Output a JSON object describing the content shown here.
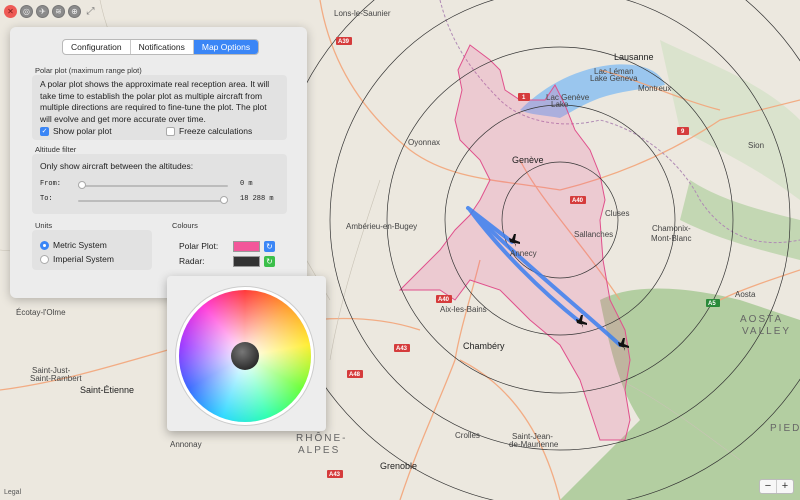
{
  "window": {
    "close_glyph": "✕",
    "toolbar_icons": [
      "radar-icon",
      "aircraft-icon",
      "layers-icon",
      "globe-icon"
    ],
    "expand_glyph": "⤢"
  },
  "tabs": [
    {
      "label": "Configuration",
      "active": false
    },
    {
      "label": "Notifications",
      "active": false
    },
    {
      "label": "Map Options",
      "active": true
    }
  ],
  "polar": {
    "title": "Polar plot (maximum range plot)",
    "lines": [
      "A polar plot shows the approximate real reception area. It will",
      "take time to establish the polar plot as multiple aircraft from",
      "multiple directions are required to fine-tune the plot. The plot",
      "will evolve and get more accurate over time."
    ],
    "show_label": "Show polar plot",
    "show_checked": true,
    "freeze_label": "Freeze calculations",
    "freeze_checked": false
  },
  "altitude": {
    "title": "Altitude filter",
    "desc": "Only show aircraft between the altitudes:",
    "from_label": "From:",
    "from_value": "0 m",
    "from_fraction": 0.0,
    "to_label": "To:",
    "to_value": "18 288 m",
    "to_fraction": 1.0
  },
  "units": {
    "title": "Units",
    "options": [
      {
        "label": "Metric System",
        "selected": true
      },
      {
        "label": "Imperial System",
        "selected": false
      }
    ]
  },
  "colours": {
    "title": "Colours",
    "polar_label": "Polar Plot:",
    "polar_color": "#f2579a",
    "radar_label": "Radar:",
    "radar_color": "#333333",
    "reset_glyph": "↻"
  },
  "map": {
    "places": {
      "lons": "Lons-le-Saunier",
      "lausanne": "Lausanne",
      "montreux": "Montreux",
      "lac_leman": "Lac Léman",
      "lake_geneva": "Lake Geneva",
      "lac_geneve": "Lac Genève",
      "lake": "Lake",
      "sion": "Sion",
      "oyonnax": "Oyonnax",
      "geneve": "Genève",
      "cluses": "Cluses",
      "amberieu": "Ambérieu-en-Bugey",
      "sallanches": "Sallanches",
      "chamonix": "Chamonix-",
      "montblanc": "Mont-Blanc",
      "annecy": "Annecy",
      "aosta": "Aosta",
      "aix": "Aix-les-Bains",
      "aosta_valley1": "AOSTA",
      "aosta_valley2": "VALLEY",
      "ecotay": "Écotay-l'Olme",
      "chambery": "Chambéry",
      "saint_just1": "Saint-Just-",
      "saint_just2": "Saint-Rambert",
      "saint_etienne": "Saint-Étienne",
      "piedmont": "PIED",
      "annonay": "Annonay",
      "rhone1": "RHÔNE-",
      "rhone2": "ALPES",
      "crolles": "Crolles",
      "saint_jean1": "Saint-Jean-",
      "saint_jean2": "de-Maurienne",
      "grenoble": "Grenoble"
    },
    "shields": [
      "A39",
      "A40",
      "1",
      "9",
      "A40",
      "A5",
      "A43",
      "A48",
      "A43"
    ],
    "aircraft_count": 3
  },
  "zoom": {
    "minus": "−",
    "plus": "+"
  },
  "legal": "Legal"
}
